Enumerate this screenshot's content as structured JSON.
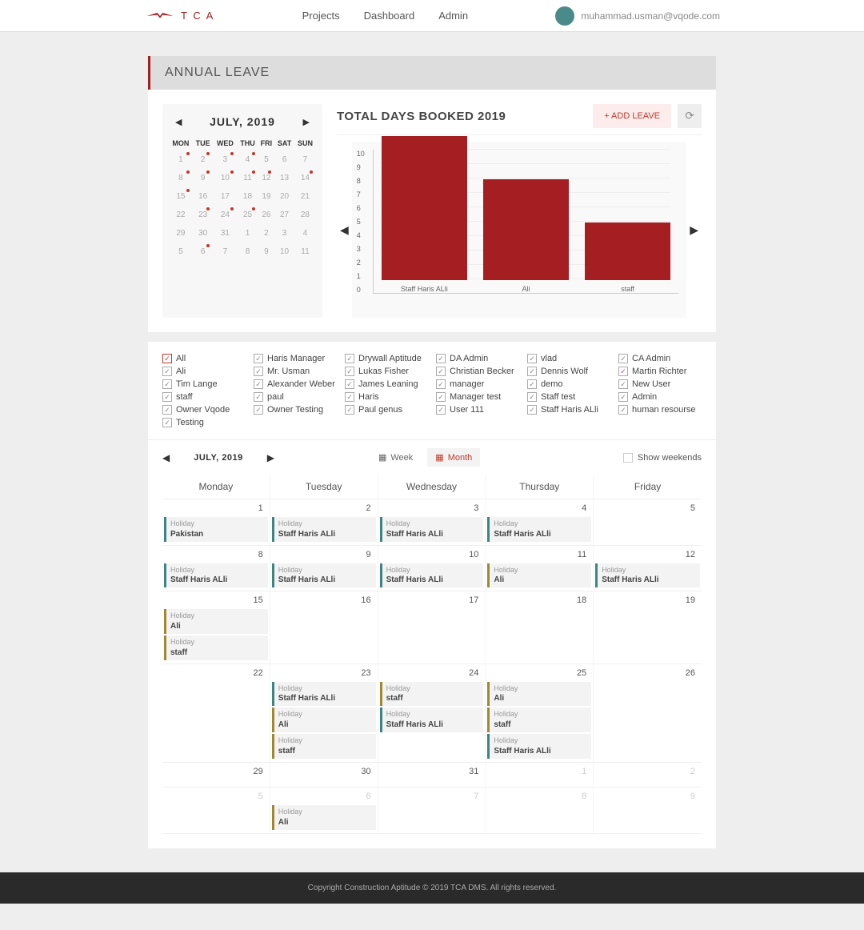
{
  "header": {
    "brand": "T C A",
    "nav": [
      "Projects",
      "Dashboard",
      "Admin"
    ],
    "user_email": "muhammad.usman@vqode.com"
  },
  "page_title": "ANNUAL LEAVE",
  "mini_calendar": {
    "title": "JULY, 2019",
    "dow": [
      "MON",
      "TUE",
      "WED",
      "THU",
      "FRI",
      "SAT",
      "SUN"
    ],
    "weeks": [
      [
        {
          "d": 1,
          "dot": true
        },
        {
          "d": 2,
          "dot": true
        },
        {
          "d": 3,
          "dot": true
        },
        {
          "d": 4,
          "dot": true
        },
        {
          "d": 5
        },
        {
          "d": 6
        },
        {
          "d": 7
        }
      ],
      [
        {
          "d": 8,
          "dot": true
        },
        {
          "d": 9,
          "dot": true
        },
        {
          "d": 10,
          "dot": true
        },
        {
          "d": 11,
          "dot": true
        },
        {
          "d": 12,
          "dot": true
        },
        {
          "d": 13
        },
        {
          "d": 14,
          "dot": true
        }
      ],
      [
        {
          "d": 15,
          "dot": true
        },
        {
          "d": 16
        },
        {
          "d": 17
        },
        {
          "d": 18
        },
        {
          "d": 19
        },
        {
          "d": 20
        },
        {
          "d": 21
        }
      ],
      [
        {
          "d": 22
        },
        {
          "d": 23,
          "dot": true
        },
        {
          "d": 24,
          "dot": true
        },
        {
          "d": 25,
          "dot": true
        },
        {
          "d": 26
        },
        {
          "d": 27
        },
        {
          "d": 28
        }
      ],
      [
        {
          "d": 29
        },
        {
          "d": 30
        },
        {
          "d": 31
        },
        {
          "d": 1,
          "muted": true
        },
        {
          "d": 2,
          "muted": true
        },
        {
          "d": 3,
          "muted": true
        },
        {
          "d": 4,
          "muted": true
        }
      ],
      [
        {
          "d": 5,
          "muted": true
        },
        {
          "d": 6,
          "muted": true,
          "dot": true
        },
        {
          "d": 7,
          "muted": true
        },
        {
          "d": 8,
          "muted": true
        },
        {
          "d": 9,
          "muted": true
        },
        {
          "d": 10,
          "muted": true
        },
        {
          "d": 11,
          "muted": true
        }
      ]
    ]
  },
  "chart_data": {
    "type": "bar",
    "title": "TOTAL DAYS BOOKED 2019",
    "categories": [
      "Staff Haris ALli",
      "Ali",
      "staff"
    ],
    "values": [
      10,
      7,
      4
    ],
    "ylim": [
      0,
      10
    ],
    "yticks": [
      0,
      1,
      2,
      3,
      4,
      5,
      6,
      7,
      8,
      9,
      10
    ],
    "add_label": "+ ADD LEAVE"
  },
  "filters": [
    {
      "label": "All",
      "cls": "red"
    },
    {
      "label": "Haris Manager"
    },
    {
      "label": "Drywall Aptitude"
    },
    {
      "label": "DA Admin"
    },
    {
      "label": "vlad"
    },
    {
      "label": "CA Admin"
    },
    {
      "label": "Ali"
    },
    {
      "label": "Mr. Usman"
    },
    {
      "label": "Lukas Fisher"
    },
    {
      "label": "Christian Becker"
    },
    {
      "label": "Dennis Wolf"
    },
    {
      "label": "Martin Richter",
      "cls": "purple"
    },
    {
      "label": "Tim Lange"
    },
    {
      "label": "Alexander Weber"
    },
    {
      "label": "James Leaning"
    },
    {
      "label": "manager"
    },
    {
      "label": "demo"
    },
    {
      "label": "New User"
    },
    {
      "label": "staff"
    },
    {
      "label": "paul"
    },
    {
      "label": "Haris"
    },
    {
      "label": "Manager test"
    },
    {
      "label": "Staff test"
    },
    {
      "label": "Admin"
    },
    {
      "label": "Owner Vqode"
    },
    {
      "label": "Owner Testing"
    },
    {
      "label": "Paul genus"
    },
    {
      "label": "User 111"
    },
    {
      "label": "Staff Haris ALli"
    },
    {
      "label": "human resourse"
    },
    {
      "label": "Testing"
    }
  ],
  "scheduler": {
    "title": "JULY, 2019",
    "week_label": "Week",
    "month_label": "Month",
    "show_weekends_label": "Show weekends",
    "dow": [
      "Monday",
      "Tuesday",
      "Wednesday",
      "Thursday",
      "Friday"
    ],
    "rows": [
      {
        "days": [
          {
            "n": 1,
            "ev": [
              {
                "t": "Holiday",
                "p": "Pakistan",
                "c": "teal"
              }
            ]
          },
          {
            "n": 2,
            "ev": [
              {
                "t": "Holiday",
                "p": "Staff Haris ALli",
                "c": "teal"
              }
            ]
          },
          {
            "n": 3,
            "ev": [
              {
                "t": "Holiday",
                "p": "Staff Haris ALli",
                "c": "teal"
              }
            ]
          },
          {
            "n": 4,
            "ev": [
              {
                "t": "Holiday",
                "p": "Staff Haris ALli",
                "c": "teal"
              }
            ]
          },
          {
            "n": 5,
            "ev": []
          }
        ]
      },
      {
        "days": [
          {
            "n": 8,
            "ev": [
              {
                "t": "Holiday",
                "p": "Staff Haris ALli",
                "c": "teal"
              }
            ]
          },
          {
            "n": 9,
            "ev": [
              {
                "t": "Holiday",
                "p": "Staff Haris ALli",
                "c": "teal"
              }
            ]
          },
          {
            "n": 10,
            "ev": [
              {
                "t": "Holiday",
                "p": "Staff Haris ALli",
                "c": "teal"
              }
            ]
          },
          {
            "n": 11,
            "ev": [
              {
                "t": "Holiday",
                "p": "Ali",
                "c": "olive"
              }
            ]
          },
          {
            "n": 12,
            "ev": [
              {
                "t": "Holiday",
                "p": "Staff Haris ALli",
                "c": "teal"
              }
            ]
          }
        ]
      },
      {
        "days": [
          {
            "n": 15,
            "ev": [
              {
                "t": "Holiday",
                "p": "Ali",
                "c": "olive"
              },
              {
                "t": "Holiday",
                "p": "staff",
                "c": "olive"
              }
            ]
          },
          {
            "n": 16,
            "ev": []
          },
          {
            "n": 17,
            "ev": []
          },
          {
            "n": 18,
            "ev": []
          },
          {
            "n": 19,
            "ev": []
          }
        ]
      },
      {
        "days": [
          {
            "n": 22,
            "ev": []
          },
          {
            "n": 23,
            "ev": [
              {
                "t": "Holiday",
                "p": "Staff Haris ALli",
                "c": "teal"
              },
              {
                "t": "Holiday",
                "p": "Ali",
                "c": "olive"
              },
              {
                "t": "Holiday",
                "p": "staff",
                "c": "olive"
              }
            ]
          },
          {
            "n": 24,
            "ev": [
              {
                "t": "Holiday",
                "p": "staff",
                "c": "olive"
              },
              {
                "t": "Holiday",
                "p": "Staff Haris ALli",
                "c": "teal"
              }
            ]
          },
          {
            "n": 25,
            "ev": [
              {
                "t": "Holiday",
                "p": "Ali",
                "c": "olive"
              },
              {
                "t": "Holiday",
                "p": "staff",
                "c": "olive"
              },
              {
                "t": "Holiday",
                "p": "Staff Haris ALli",
                "c": "teal"
              }
            ]
          },
          {
            "n": 26,
            "ev": []
          }
        ]
      },
      {
        "days": [
          {
            "n": 29,
            "ev": []
          },
          {
            "n": 30,
            "ev": []
          },
          {
            "n": 31,
            "ev": []
          },
          {
            "n": 1,
            "muted": true,
            "ev": []
          },
          {
            "n": 2,
            "muted": true,
            "ev": []
          }
        ]
      },
      {
        "days": [
          {
            "n": 5,
            "muted": true,
            "ev": []
          },
          {
            "n": 6,
            "muted": true,
            "ev": [
              {
                "t": "Holiday",
                "p": "Ali",
                "c": "olive"
              }
            ]
          },
          {
            "n": 7,
            "muted": true,
            "ev": []
          },
          {
            "n": 8,
            "muted": true,
            "ev": []
          },
          {
            "n": 9,
            "muted": true,
            "ev": []
          }
        ]
      }
    ]
  },
  "footer": "Copyright Construction Aptitude © 2019 TCA DMS. All rights reserved."
}
